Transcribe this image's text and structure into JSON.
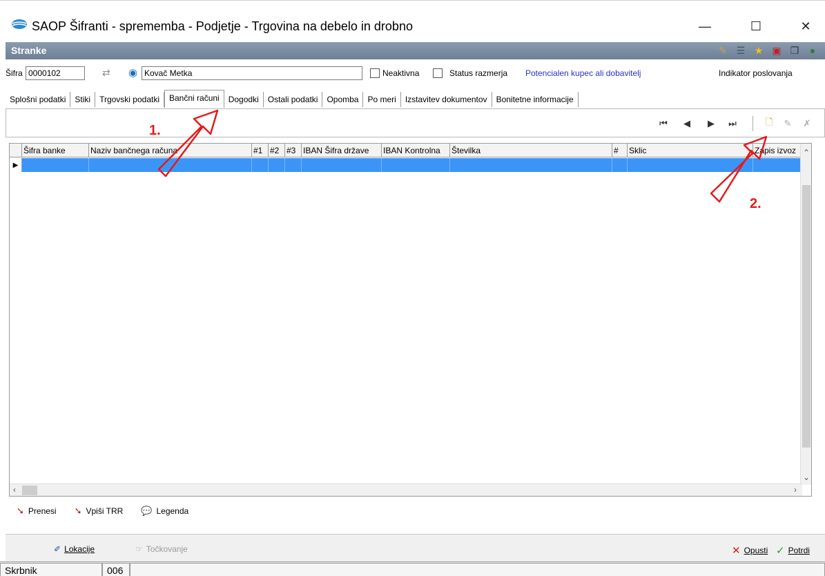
{
  "window": {
    "title": "SAOP Šifranti - sprememba - Podjetje - Trgovina na debelo in drobno",
    "minimize": "—",
    "maximize": "☐",
    "close": "✕"
  },
  "header": {
    "title": "Stranke",
    "icons": [
      "edit-icon",
      "list-icon",
      "star-icon",
      "pdf-icon",
      "copy-icon",
      "globe-icon"
    ]
  },
  "client": {
    "sifra_label": "Šifra",
    "sifra_value": "0000102",
    "name_value": "Kovač Metka",
    "neaktivna_label": "Neaktivna",
    "status_label": "Status razmerja",
    "status_value": "Potencialen kupec ali dobavitelj",
    "indicator_label": "Indikator poslovanja"
  },
  "tabs": [
    {
      "label": "Splošni podatki"
    },
    {
      "label": "Stiki"
    },
    {
      "label": "Trgovski podatki"
    },
    {
      "label": "Bančni računi",
      "active": true
    },
    {
      "label": "Dogodki"
    },
    {
      "label": "Ostali podatki"
    },
    {
      "label": "Opomba"
    },
    {
      "label": "Po meri"
    },
    {
      "label": "Izstavitev dokumentov"
    },
    {
      "label": "Bonitetne informacije"
    }
  ],
  "grid": {
    "columns": [
      "Šifra banke",
      "Naziv bančnega računa",
      "#1",
      "#2",
      "#3",
      "IBAN Šifra države",
      "IBAN Kontrolna",
      "Številka",
      "#",
      "Sklic",
      "Zapis izvoz"
    ]
  },
  "actions": {
    "prenesi": "Prenesi",
    "vpisi_trr": "Vpiši TRR",
    "legenda": "Legenda"
  },
  "bottom": {
    "lokacije": "Lokacije",
    "tockovanje": "Točkovanje",
    "opusti": "Opusti",
    "potrdi": "Potrdi"
  },
  "status": {
    "user": "Skrbnik",
    "code": "006"
  },
  "annotations": {
    "step1": "1.",
    "step2": "2."
  },
  "colors": {
    "selection": "#3b95f7",
    "annotation": "#e31b1b",
    "header": "#7a8aa0"
  }
}
